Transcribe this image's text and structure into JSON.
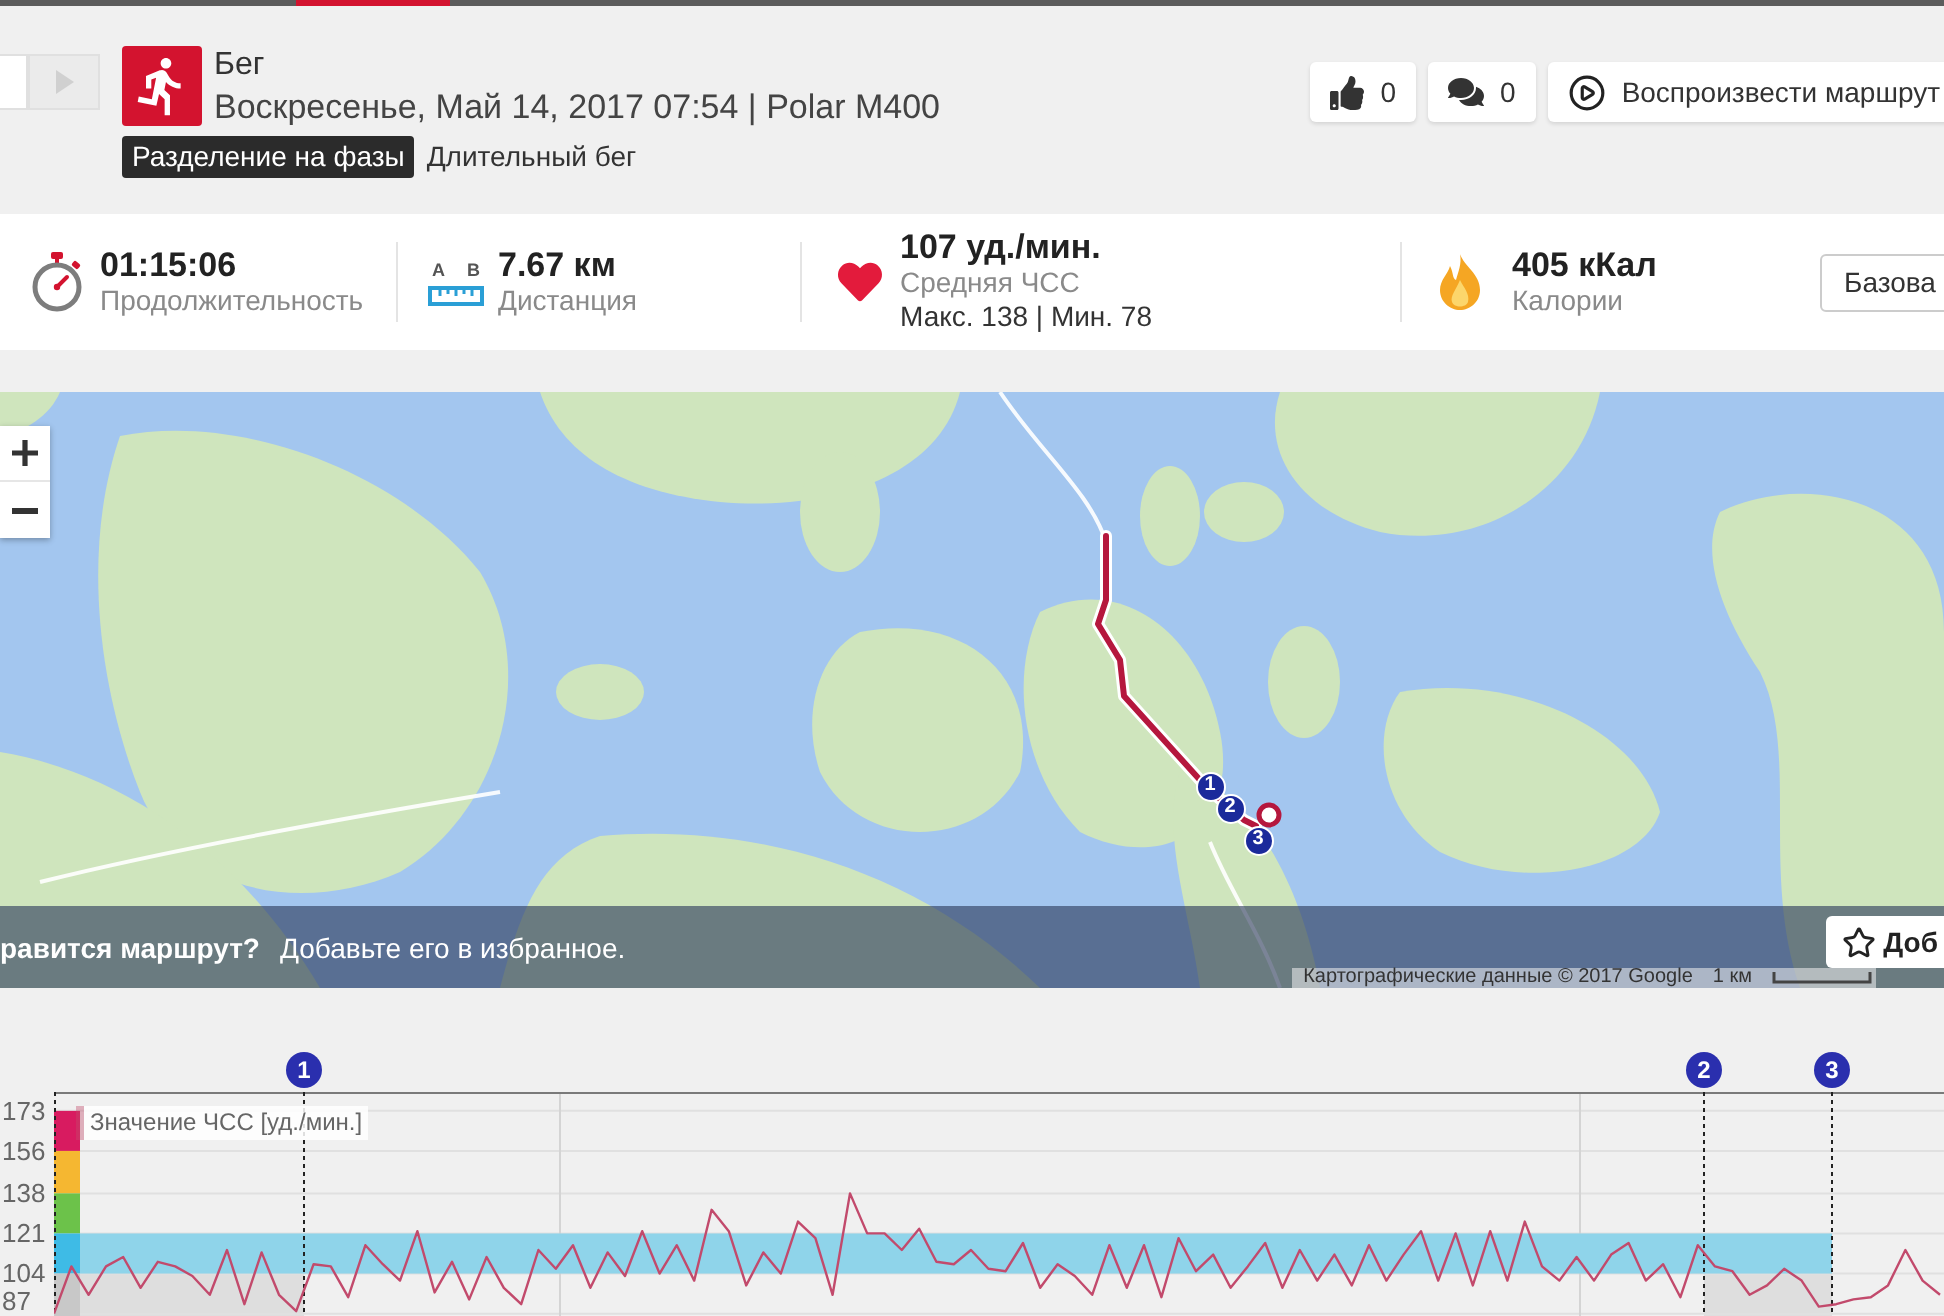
{
  "header": {
    "nav": {
      "next_disabled": true
    },
    "title": "Бег",
    "subtitle": "Воскресенье, Май 14, 2017 07:54 | Polar M400",
    "tag": "Разделение на фазы",
    "phase_type": "Длительный бег",
    "actions": [
      {
        "kind": "like",
        "label": "0"
      },
      {
        "kind": "comment",
        "label": "0"
      },
      {
        "kind": "replay",
        "label": "Воспроизвести маршрут"
      }
    ]
  },
  "stats": [
    {
      "kind": "duration",
      "value": "01:15:06",
      "label": "Продолжительность"
    },
    {
      "kind": "distance",
      "icon_labels": [
        "A",
        "B"
      ],
      "value": "7.67 км",
      "label": "Дистанция"
    },
    {
      "kind": "heart_rate",
      "value": "107 уд./мин.",
      "label": "Средняя ЧСС",
      "detail": "Макс. 138 | Мин. 78"
    },
    {
      "kind": "calories",
      "value": "405 кКал",
      "label": "Калории"
    }
  ],
  "view_button": "Базова",
  "map": {
    "markers": [
      "1",
      "2",
      "3"
    ],
    "banner": {
      "question": "равится маршрут?",
      "text": "Добавьте его в избранное.",
      "button": "Доб"
    },
    "attribution": "Картографические данные © 2017 Google",
    "scale": "1 км"
  },
  "chart": {
    "markers": [
      "1",
      "2",
      "3"
    ],
    "zones": [
      {
        "color": "#d81b60"
      },
      {
        "color": "#f5b731"
      },
      {
        "color": "#6cc24a"
      },
      {
        "color": "#3ebbe6"
      },
      {
        "color": "#c8c8c8"
      }
    ],
    "chart_data": {
      "type": "line",
      "ylim": [
        86,
        181
      ],
      "yticks": [
        87,
        104,
        121,
        138,
        156,
        173
      ],
      "grid": true,
      "bands": [
        {
          "axis": "y",
          "from": 104,
          "to": 121,
          "color": "#8fd4ea"
        }
      ],
      "series": [
        {
          "name": "Значение ЧСС [уд./мин.]",
          "color": "#c24a6c",
          "values": [
            87,
            107,
            95,
            107,
            111,
            98,
            109,
            107,
            103,
            95,
            114,
            91,
            113,
            95,
            88,
            108,
            107,
            94,
            116,
            108,
            101,
            122,
            96,
            109,
            93,
            111,
            98,
            91,
            114,
            106,
            116,
            98,
            113,
            103,
            122,
            104,
            116,
            101,
            131,
            122,
            99,
            113,
            104,
            126,
            119,
            95,
            138,
            121,
            121,
            114,
            123,
            109,
            108,
            114,
            106,
            105,
            117,
            98,
            108,
            103,
            95,
            116,
            98,
            116,
            94,
            119,
            105,
            112,
            98,
            107,
            117,
            98,
            114,
            101,
            112,
            99,
            116,
            101,
            112,
            122,
            101,
            121,
            99,
            122,
            101,
            126,
            107,
            101,
            111,
            101,
            112,
            117,
            101,
            108,
            94,
            116,
            107,
            105,
            95,
            99,
            106,
            101,
            90,
            91,
            93,
            94,
            99,
            114,
            101,
            95
          ]
        }
      ]
    }
  }
}
